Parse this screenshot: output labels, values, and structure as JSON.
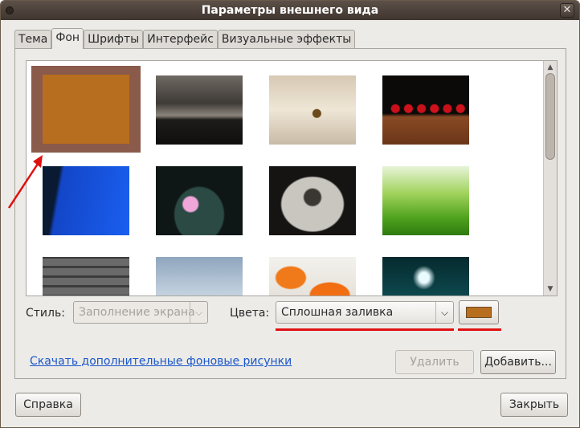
{
  "window": {
    "title": "Параметры внешнего вида"
  },
  "tabs": [
    {
      "label": "Тема",
      "active": false
    },
    {
      "label": "Фон",
      "active": true
    },
    {
      "label": "Шрифты",
      "active": false
    },
    {
      "label": "Интерфейс",
      "active": false
    },
    {
      "label": "Визуальные эффекты",
      "active": false
    }
  ],
  "wallpapers": {
    "selected_color": "#b86e1f",
    "items": [
      {
        "name": "solid-color"
      },
      {
        "name": "dark-sea-sky"
      },
      {
        "name": "butterfly-on-plant"
      },
      {
        "name": "cherries-on-wood"
      },
      {
        "name": "blue-sky-cliff"
      },
      {
        "name": "water-lily"
      },
      {
        "name": "hands-with-seeds"
      },
      {
        "name": "green-grass"
      },
      {
        "name": "stone-wall"
      },
      {
        "name": "pale-sky"
      },
      {
        "name": "orange-flowers"
      },
      {
        "name": "water-reflection"
      }
    ]
  },
  "controls": {
    "style_label": "Стиль:",
    "style_value": "Заполнение экрана",
    "colors_label": "Цвета:",
    "colors_value": "Сплошная заливка",
    "color_swatch": "#b86e1f"
  },
  "links": {
    "download": "Скачать дополнительные фоновые рисунки"
  },
  "buttons": {
    "remove": "Удалить",
    "add": "Добавить...",
    "help": "Справка",
    "close": "Закрыть"
  },
  "annotation_color": "#e01010"
}
